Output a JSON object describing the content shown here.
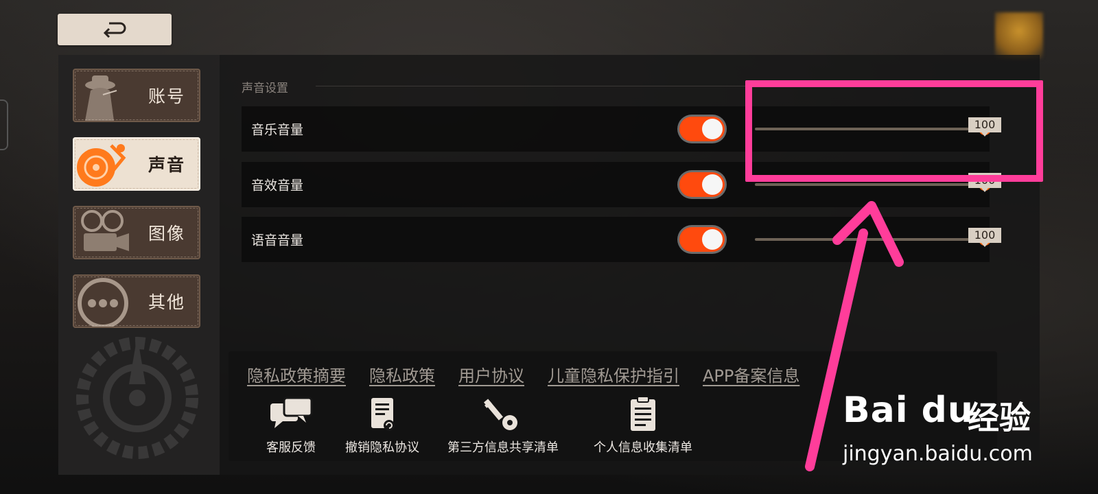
{
  "header": {
    "back_button_label": "back"
  },
  "sidebar": {
    "tabs": [
      {
        "label": "账号",
        "icon": "detective-icon",
        "active": false
      },
      {
        "label": "声音",
        "icon": "turntable-icon",
        "active": true
      },
      {
        "label": "图像",
        "icon": "film-camera-icon",
        "active": false
      },
      {
        "label": "其他",
        "icon": "more-dots-icon",
        "active": false
      }
    ]
  },
  "sound_settings": {
    "section_title": "声音设置",
    "rows": [
      {
        "label": "音乐音量",
        "enabled": true,
        "value": "100",
        "level": 1.0
      },
      {
        "label": "音效音量",
        "enabled": true,
        "value": "100",
        "level": 1.0
      },
      {
        "label": "语音音量",
        "enabled": true,
        "value": "100",
        "level": 1.0
      }
    ]
  },
  "footer": {
    "links": [
      "隐私政策摘要",
      "隐私政策",
      "用户协议",
      "儿童隐私保护指引",
      "APP备案信息"
    ],
    "actions": [
      {
        "label": "客服反馈",
        "icon": "chat-bubbles-icon"
      },
      {
        "label": "撤销隐私协议",
        "icon": "document-revoke-icon"
      },
      {
        "label": "第三方信息共享清单",
        "icon": "key-icon"
      },
      {
        "label": "个人信息收集清单",
        "icon": "clipboard-icon"
      }
    ]
  },
  "watermark": {
    "brand": "Bai du",
    "cn": "经验",
    "url": "jingyan.baidu.com"
  },
  "colors": {
    "accent": "#ff4a0e",
    "highlight": "#ff3d9a",
    "tab_active_bg": "#ede1d2",
    "tab_bg": "#4a3a31"
  }
}
